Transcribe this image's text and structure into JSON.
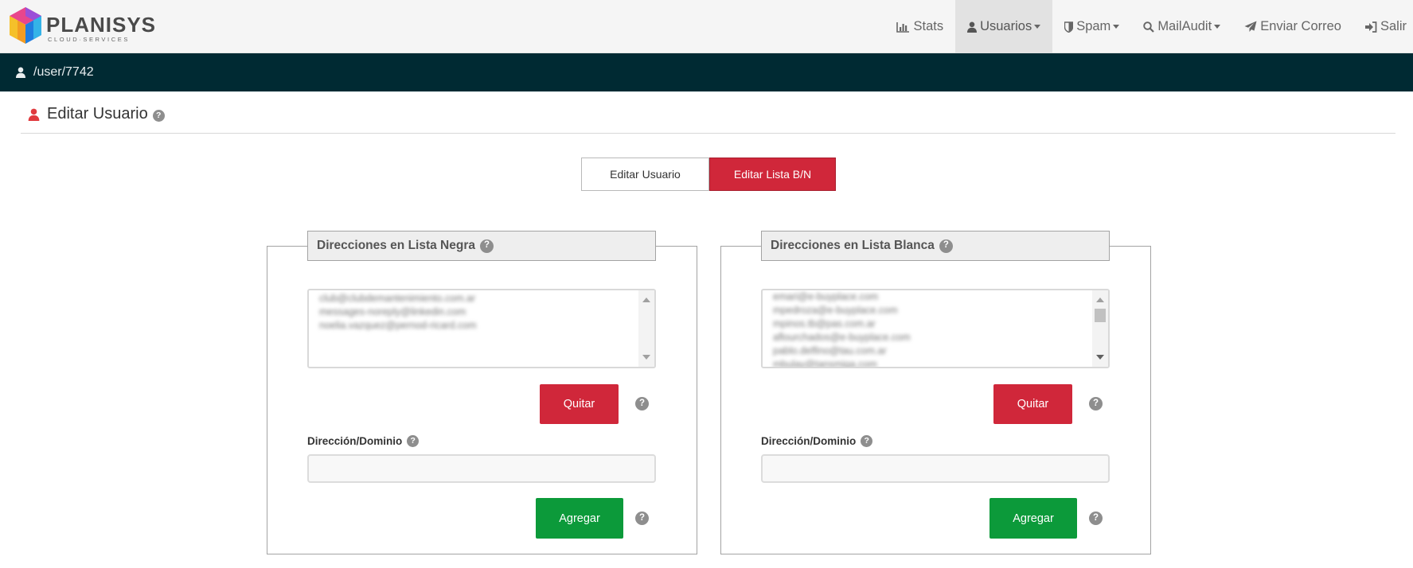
{
  "brand": {
    "name": "PLANISYS",
    "tagline": "CLOUD·SERVICES"
  },
  "nav": [
    {
      "label": "Stats",
      "icon": "bar-chart-icon",
      "dropdown": false,
      "active": false
    },
    {
      "label": "Usuarios",
      "icon": "user-icon",
      "dropdown": true,
      "active": true
    },
    {
      "label": "Spam",
      "icon": "shield-icon",
      "dropdown": true,
      "active": false
    },
    {
      "label": "MailAudit",
      "icon": "search-icon",
      "dropdown": true,
      "active": false
    },
    {
      "label": "Enviar Correo",
      "icon": "paper-plane-icon",
      "dropdown": false,
      "active": false
    },
    {
      "label": "Salir",
      "icon": "sign-out-icon",
      "dropdown": false,
      "active": false
    }
  ],
  "path": "/user/7742",
  "page": {
    "title": "Editar Usuario",
    "help": "?"
  },
  "tabs": [
    {
      "label": "Editar Usuario",
      "active": false
    },
    {
      "label": "Editar Lista B/N",
      "active": true
    }
  ],
  "blacklist": {
    "title": "Direcciones en Lista Negra",
    "items": [
      "club@clubdemantenimiento.com.ar",
      "messages-noreply@linkedin.com",
      "noelia.vazquez@pernod-ricard.com"
    ],
    "remove_label": "Quitar",
    "field_label": "Dirección/Dominio",
    "field_value": "",
    "field_placeholder": "",
    "add_label": "Agregar"
  },
  "whitelist": {
    "title": "Direcciones en Lista Blanca",
    "items": [
      "emari@e-buyplace.com",
      "mpedroza@e-buyplace.com",
      "mpinos.tb@pas.com.ar",
      "aflourchados@e-buyplace.com",
      "pablo.delfino@tau.com.ar",
      "mbulay@tansmiga.com"
    ],
    "remove_label": "Quitar",
    "field_label": "Dirección/Dominio",
    "field_value": "",
    "field_placeholder": "",
    "add_label": "Agregar"
  },
  "colors": {
    "navbar_bg": "#f5f5f5",
    "pathbar_bg": "#002a33",
    "accent_red": "#d0273a",
    "accent_green": "#0c9a3a",
    "user_icon_red": "#e03a3e"
  }
}
